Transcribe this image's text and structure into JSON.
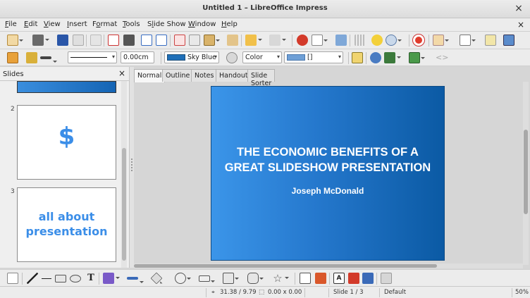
{
  "window": {
    "title": "Untitled 1 – LibreOffice Impress",
    "close_glyph": "×",
    "doc_close_glyph": "×"
  },
  "menu": [
    {
      "pre": "",
      "u": "F",
      "post": "ile"
    },
    {
      "pre": "",
      "u": "E",
      "post": "dit"
    },
    {
      "pre": "",
      "u": "V",
      "post": "iew"
    },
    {
      "pre": "",
      "u": "I",
      "post": "nsert"
    },
    {
      "pre": "F",
      "u": "o",
      "post": "rmat"
    },
    {
      "pre": "",
      "u": "T",
      "post": "ools"
    },
    {
      "pre": "S",
      "u": "l",
      "post": "ide Show"
    },
    {
      "pre": "",
      "u": "W",
      "post": "indow"
    },
    {
      "pre": "",
      "u": "H",
      "post": "elp"
    }
  ],
  "format_toolbar": {
    "line_width": "0.00cm",
    "line_color": "Sky Blue",
    "line_color_hex": "#1f6fb8",
    "area_style": "Color",
    "area_color_hex": "#6e9fd6",
    "area_extra": "[]",
    "combo_arrow": "▾"
  },
  "slides_pane": {
    "title": "Slides",
    "close_glyph": "×",
    "thumbnails": [
      {
        "number": "2",
        "text": "$"
      },
      {
        "number": "3",
        "line1": "all about",
        "line2": "presentation"
      }
    ]
  },
  "view_tabs": [
    "Normal",
    "Outline",
    "Notes",
    "Handout",
    "Slide Sorter"
  ],
  "slide": {
    "title_line1": "THE ECONOMIC BENEFITS OF A",
    "title_line2": "GREAT SLIDESHOW PRESENTATION",
    "subtitle": "Joseph McDonald"
  },
  "status": {
    "position": "31.38 / 9.79",
    "size": "0.00 x 0.00",
    "slide": "Slide 1 / 3",
    "layout": "Default",
    "zoom": "50%"
  }
}
